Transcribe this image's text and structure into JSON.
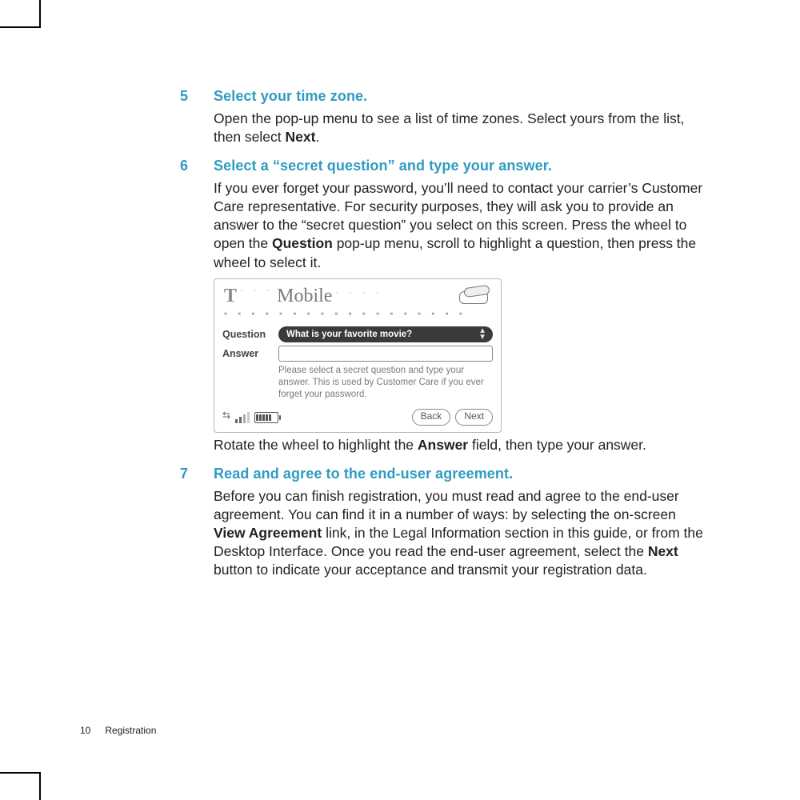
{
  "colors": {
    "accent": "#2f9bc1"
  },
  "steps": {
    "s5": {
      "num": "5",
      "title": "Select your time zone.",
      "body_a": "Open the pop-up menu to see a list of time zones. Select yours from the list, then select ",
      "body_b": "Next",
      "body_c": "."
    },
    "s6": {
      "num": "6",
      "title": "Select a “secret question” and type your answer.",
      "body_a": "If you ever forget your password, you’ll need to contact your carrier’s Customer Care representative. For security purposes, they will ask you to provide an answer to the “secret question” you select on this screen. Press the wheel to open the ",
      "body_b": "Question",
      "body_c": " pop-up menu, scroll to highlight a question, then press the wheel to select it.",
      "caption_a": "Rotate the wheel to highlight the ",
      "caption_b": "Answer",
      "caption_c": " field, then type your answer."
    },
    "s7": {
      "num": "7",
      "title": "Read and agree to the end-user agreement.",
      "body_a": "Before you can finish registration, you must read and agree to the end-user agreement. You can find it in a number of ways: by selecting the on-screen ",
      "body_b": "View Agreement",
      "body_c": " link, in the Legal Information section in this guide, or from the Desktop Interface. Once you read the end-user agreement, select the ",
      "body_d": "Next",
      "body_e": " button to indicate your acceptance and transmit your registration data."
    }
  },
  "device": {
    "brand_t": "T",
    "brand_dots": "· · ·",
    "brand_mobile": "Mobile",
    "trail_dots": "· ·  · ·",
    "question_label": "Question",
    "question_value": "What is your favorite movie?",
    "answer_label": "Answer",
    "helper": "Please select a secret question and type your answer. This is used by Customer Care if you ever forget your password.",
    "back": "Back",
    "next": "Next"
  },
  "footer": {
    "page": "10",
    "section": "Registration"
  }
}
